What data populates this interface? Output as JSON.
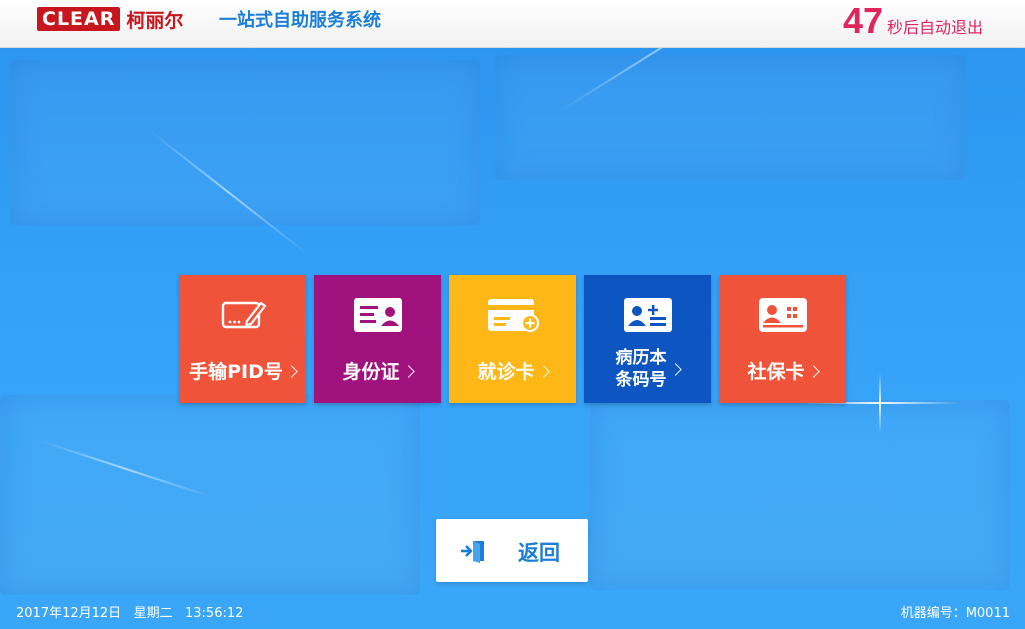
{
  "header": {
    "logo_en": "CLEAR",
    "logo_cn": "柯丽尔",
    "system_title": "一站式自助服务系统",
    "countdown_number": "47",
    "countdown_text": "秒后自动退出"
  },
  "tiles": [
    {
      "label": "手输PID号",
      "icon": "pen-input-icon",
      "color": "#ef543b"
    },
    {
      "label": "身份证",
      "icon": "id-card-icon",
      "color": "#a0127d"
    },
    {
      "label": "就诊卡",
      "icon": "medical-card-icon",
      "color": "#fdb716"
    },
    {
      "label_line1": "病历本",
      "label_line2": "条码号",
      "icon": "medical-record-barcode-icon",
      "color": "#0d56c2"
    },
    {
      "label": "社保卡",
      "icon": "social-security-card-icon",
      "color": "#ef543b"
    }
  ],
  "back_button": {
    "label": "返回",
    "icon": "exit-door-icon"
  },
  "footer": {
    "date": "2017年12月12日",
    "weekday": "星期二",
    "time": "13:56:12",
    "machine_id": "机器编号：M0011"
  },
  "colors": {
    "accent": "#1b7fd8",
    "countdown": "#e0245e",
    "brand_red": "#c8161e"
  }
}
